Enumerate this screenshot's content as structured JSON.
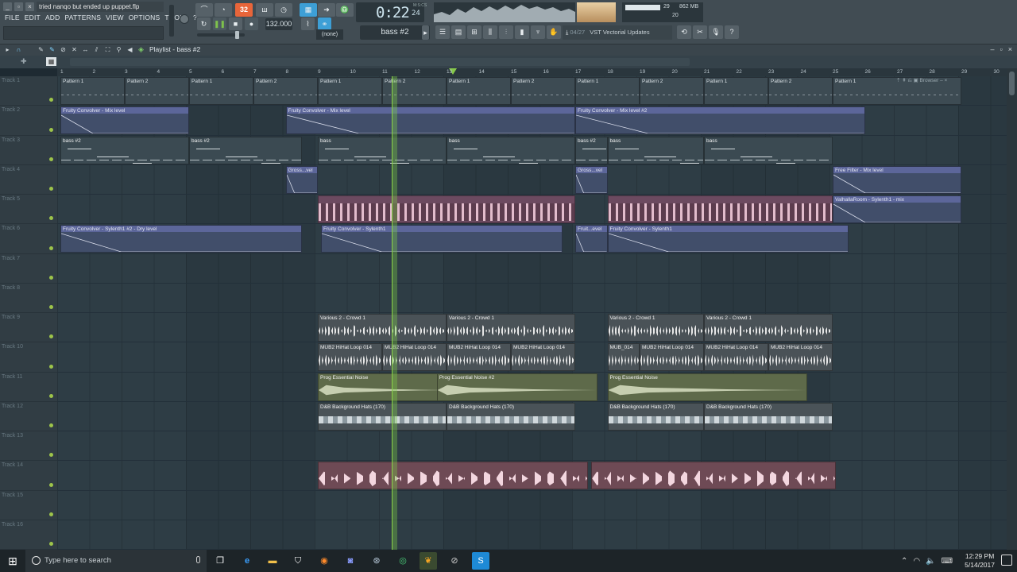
{
  "window": {
    "project_title": "tried nanqo but ended up puppet.flp",
    "menu": [
      "FILE",
      "EDIT",
      "ADD",
      "PATTERNS",
      "VIEW",
      "OPTIONS",
      "TOOLS",
      "?"
    ]
  },
  "transport": {
    "pattern_mode_label": "32",
    "tempo": "132.000",
    "time_main": "0:22",
    "time_sub": "24",
    "time_tag": "M:S:CS",
    "snap": "(none)",
    "pattern": "bass #2",
    "cpu_value": "29",
    "memory": "862 MB",
    "poly": "20",
    "hint_counter": "04/27",
    "hint_text": "VST Vectorial Updates"
  },
  "playlist": {
    "title": "Playlist - bass #2",
    "browser_label": "Browser",
    "ruler": [
      "1",
      "2",
      "3",
      "4",
      "5",
      "6",
      "7",
      "8",
      "9",
      "10",
      "11",
      "12",
      "13",
      "14",
      "15",
      "16",
      "17",
      "18",
      "19",
      "20",
      "21",
      "22",
      "23",
      "24",
      "25",
      "26",
      "27",
      "28",
      "29",
      "30"
    ],
    "tracks": [
      {
        "label": "Track 1",
        "clips": [
          {
            "kind": "pattern",
            "name": "Pattern 1",
            "bar": 1,
            "len": 2
          },
          {
            "kind": "pattern",
            "name": "Pattern 2",
            "bar": 3,
            "len": 2
          },
          {
            "kind": "pattern",
            "name": "Pattern 1",
            "bar": 5,
            "len": 2
          },
          {
            "kind": "pattern",
            "name": "Pattern 2",
            "bar": 7,
            "len": 2
          },
          {
            "kind": "pattern",
            "name": "Pattern 1",
            "bar": 9,
            "len": 2
          },
          {
            "kind": "pattern",
            "name": "Pattern 2",
            "bar": 11,
            "len": 2
          },
          {
            "kind": "pattern",
            "name": "Pattern 1",
            "bar": 13,
            "len": 2
          },
          {
            "kind": "pattern",
            "name": "Pattern 2",
            "bar": 15,
            "len": 2
          },
          {
            "kind": "pattern",
            "name": "Pattern 1",
            "bar": 17,
            "len": 2
          },
          {
            "kind": "pattern",
            "name": "Pattern 2",
            "bar": 19,
            "len": 2
          },
          {
            "kind": "pattern",
            "name": "Pattern 1",
            "bar": 21,
            "len": 2
          },
          {
            "kind": "pattern",
            "name": "Pattern 2",
            "bar": 23,
            "len": 2
          },
          {
            "kind": "pattern",
            "name": "Pattern 1",
            "bar": 25,
            "len": 4
          }
        ]
      },
      {
        "label": "Track 2",
        "clips": [
          {
            "kind": "auto",
            "name": "Fruity Convolver - Mix level",
            "bar": 1,
            "len": 4
          },
          {
            "kind": "auto",
            "name": "Fruity Convolver - Mix level",
            "bar": 8,
            "len": 9
          },
          {
            "kind": "auto",
            "name": "Fruity Convolver - Mix level #2",
            "bar": 17,
            "len": 9
          }
        ]
      },
      {
        "label": "Track 3",
        "clips": [
          {
            "kind": "bass",
            "name": "bass #2",
            "bar": 1,
            "len": 4
          },
          {
            "kind": "bass",
            "name": "bass #2",
            "bar": 5,
            "len": 3.5
          },
          {
            "kind": "bass",
            "name": "bass",
            "bar": 9,
            "len": 4
          },
          {
            "kind": "bass",
            "name": "bass",
            "bar": 13,
            "len": 4
          },
          {
            "kind": "bass",
            "name": "bass #2",
            "bar": 17,
            "len": 1
          },
          {
            "kind": "bass",
            "name": "bass",
            "bar": 18,
            "len": 3
          },
          {
            "kind": "bass",
            "name": "bass",
            "bar": 21,
            "len": 4
          }
        ]
      },
      {
        "label": "Track 4",
        "clips": [
          {
            "kind": "auto",
            "name": "Gross...vel",
            "bar": 8,
            "len": 1
          },
          {
            "kind": "auto",
            "name": "Gross...vel",
            "bar": 17,
            "len": 1
          },
          {
            "kind": "auto",
            "name": "Free Filter - Mix level",
            "bar": 25,
            "len": 4
          }
        ]
      },
      {
        "label": "Track 5",
        "clips": [
          {
            "kind": "synth",
            "name": "",
            "bar": 9,
            "len": 8
          },
          {
            "kind": "synth",
            "name": "",
            "bar": 18,
            "len": 7
          },
          {
            "kind": "auto",
            "name": "ValhallaRoom - Sylenth1 - mix",
            "bar": 25,
            "len": 4
          }
        ]
      },
      {
        "label": "Track 6",
        "clips": [
          {
            "kind": "auto",
            "name": "Fruity Convolver - Sylenth1 #2 - Dry level",
            "bar": 1,
            "len": 7.5
          },
          {
            "kind": "auto",
            "name": "Fruity Convolver - Sylenth1",
            "bar": 9.1,
            "len": 7.5
          },
          {
            "kind": "auto",
            "name": "Fruit...evel",
            "bar": 17,
            "len": 1
          },
          {
            "kind": "auto",
            "name": "Fruity Convolver - Sylenth1",
            "bar": 18,
            "len": 7.5
          }
        ]
      },
      {
        "label": "Track 7",
        "clips": []
      },
      {
        "label": "Track 8",
        "clips": []
      },
      {
        "label": "Track 9",
        "clips": [
          {
            "kind": "audio",
            "name": "Various 2 - Crowd 1",
            "bar": 9,
            "len": 4
          },
          {
            "kind": "audio",
            "name": "Various 2 - Crowd 1",
            "bar": 13,
            "len": 4
          },
          {
            "kind": "audio",
            "name": "Various 2 - Crowd 1",
            "bar": 18,
            "len": 3
          },
          {
            "kind": "audio",
            "name": "Various 2 - Crowd 1",
            "bar": 21,
            "len": 4
          }
        ]
      },
      {
        "label": "Track 10",
        "clips": [
          {
            "kind": "audio",
            "name": "MUB2 HiHat Loop 014",
            "bar": 9,
            "len": 2
          },
          {
            "kind": "audio",
            "name": "MUB2 HiHat Loop 014",
            "bar": 11,
            "len": 2
          },
          {
            "kind": "audio",
            "name": "MUB2 HiHat Loop 014",
            "bar": 13,
            "len": 2
          },
          {
            "kind": "audio",
            "name": "MUB2 HiHat Loop 014",
            "bar": 15,
            "len": 2
          },
          {
            "kind": "audio",
            "name": "MUB_014",
            "bar": 18,
            "len": 1
          },
          {
            "kind": "audio",
            "name": "MUB2 HiHat Loop 014",
            "bar": 19,
            "len": 2
          },
          {
            "kind": "audio",
            "name": "MUB2 HiHat Loop 014",
            "bar": 21,
            "len": 2
          },
          {
            "kind": "audio",
            "name": "MUB2 HiHat Loop 014",
            "bar": 23,
            "len": 2
          }
        ]
      },
      {
        "label": "Track 11",
        "clips": [
          {
            "kind": "noise",
            "name": "Prog Essential Noise",
            "bar": 9,
            "len": 4
          },
          {
            "kind": "noise",
            "name": "Prog Essential Noise #2",
            "bar": 12.7,
            "len": 5
          },
          {
            "kind": "noise",
            "name": "Prog Essential Noise",
            "bar": 18,
            "len": 6.2
          }
        ]
      },
      {
        "label": "Track 12",
        "clips": [
          {
            "kind": "hats",
            "name": "D&B Background Hats (170)",
            "bar": 9,
            "len": 4
          },
          {
            "kind": "hats",
            "name": "D&B Background Hats (170)",
            "bar": 13,
            "len": 4
          },
          {
            "kind": "hats",
            "name": "D&B Background Hats (170)",
            "bar": 18,
            "len": 3
          },
          {
            "kind": "hats",
            "name": "D&B Background Hats (170)",
            "bar": 21,
            "len": 4
          }
        ]
      },
      {
        "label": "Track 13",
        "clips": []
      },
      {
        "label": "Track 14",
        "clips": [
          {
            "kind": "loop",
            "name": "",
            "bar": 9,
            "len": 8.4
          },
          {
            "kind": "loop",
            "name": "",
            "bar": 17.5,
            "len": 7.6
          }
        ]
      },
      {
        "label": "Track 15",
        "clips": []
      },
      {
        "label": "Track 16",
        "clips": []
      }
    ]
  },
  "taskbar": {
    "search_placeholder": "Type here to search",
    "time": "12:29 PM",
    "date": "5/14/2017"
  },
  "colors": {
    "accent_green": "#8ad04a",
    "pattern_orange": "#e8653a",
    "lane_bg": "#2e3d45"
  }
}
